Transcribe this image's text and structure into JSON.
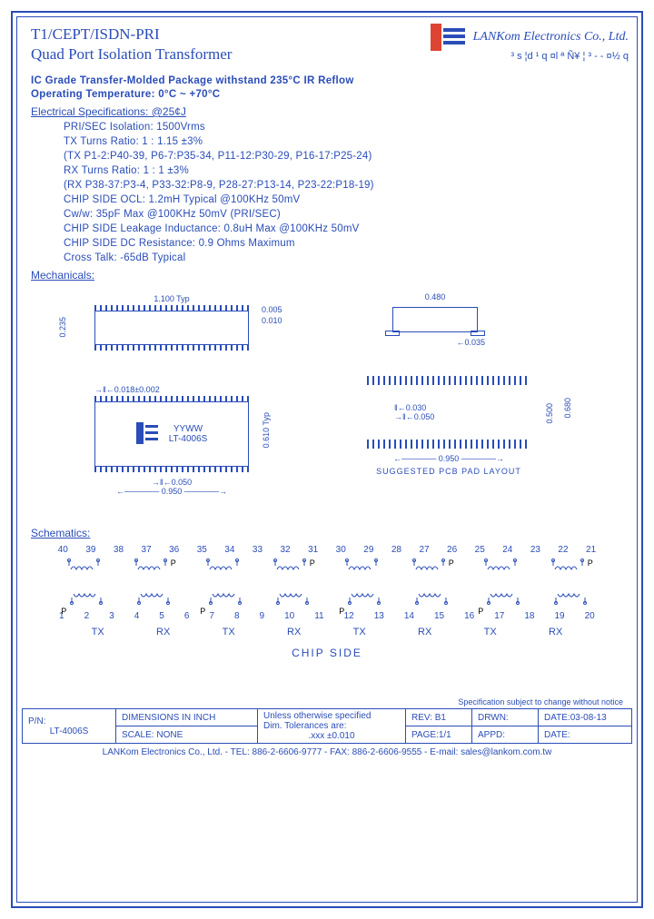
{
  "header": {
    "title1": "T1/CEPT/ISDN-PRI",
    "title2": "Quad Port Isolation Transformer",
    "company_name": "LANKom Electronics Co., Ltd.",
    "company_sub": "³ s ¦d ¹ q ¤l ª Ñ¥ ¦ ³  - -  ¤½ q"
  },
  "grade_line1": "IC Grade Transfer-Molded Package withstand 235°C IR Reflow",
  "grade_line2": "Operating Temperature: 0°C ~ +70°C",
  "elec_header": "Electrical Specifications: @25¢J",
  "specs": {
    "iso": "PRI/SEC Isolation: 1500Vrms",
    "tx_ratio": "TX Turns Ratio: 1 : 1.15 ±3%",
    "tx_pins": "(TX P1-2:P40-39, P6-7:P35-34, P11-12:P30-29, P16-17:P25-24)",
    "rx_ratio": "RX Turns Ratio: 1 : 1 ±3%",
    "rx_pins": "(RX P38-37:P3-4, P33-32:P8-9, P28-27:P13-14, P23-22:P18-19)",
    "ocl": "CHIP SIDE OCL: 1.2mH Typical @100KHz 50mV",
    "cww": "Cw/w: 35pF Max @100KHz 50mV (PRI/SEC)",
    "leak": "CHIP SIDE Leakage Inductance: 0.8uH Max @100KHz 50mV",
    "dcr": "CHIP SIDE DC Resistance: 0.9 Ohms Maximum",
    "xtalk": "Cross Talk: -65dB Typical"
  },
  "mech_header": "Mechanicals:",
  "mech": {
    "d1": "1.100 Typ",
    "d2": "0.235",
    "d3": "0.005",
    "d4": "0.010",
    "d5": "0.480",
    "d6": "0.035",
    "d7": "0.018±0.002",
    "d8": "0.610 Typ",
    "d9": "0.050",
    "d10": "0.950",
    "d11": "0.030",
    "d12": "0.050",
    "d13": "0.500",
    "d14": "0.680",
    "d15": "0.950",
    "pcb_label": "SUGGESTED PCB PAD LAYOUT",
    "chip_mark1": "YYWW",
    "chip_mark2": "LT-4006S"
  },
  "schem_header": "Schematics:",
  "schem": {
    "top_pins": [
      "40",
      "39",
      "38",
      "37",
      "36",
      "35",
      "34",
      "33",
      "32",
      "31",
      "30",
      "29",
      "28",
      "27",
      "26",
      "25",
      "24",
      "23",
      "22",
      "21"
    ],
    "bot_pins": [
      "1",
      "2",
      "3",
      "4",
      "5",
      "6",
      "7",
      "8",
      "9",
      "10",
      "11",
      "12",
      "13",
      "14",
      "15",
      "16",
      "17",
      "18",
      "19",
      "20"
    ],
    "labels": [
      "TX",
      "RX",
      "TX",
      "RX",
      "TX",
      "RX",
      "TX",
      "RX"
    ],
    "p": "P",
    "chipside": "CHIP SIDE"
  },
  "notice": "Specification subject to change without notice",
  "titleblock": {
    "pn_label": "P/N:",
    "pn": "LT-4006S",
    "dim": "DIMENSIONS IN INCH",
    "scale": "SCALE: NONE",
    "tol1": "Unless otherwise specified",
    "tol2": "Dim. Tolerances are:",
    "tol3": ".xxx ±0.010",
    "rev": "REV: B1",
    "page": "PAGE:1/1",
    "drwn": "DRWN:",
    "appd": "APPD:",
    "date1": "DATE:03-08-13",
    "date2": "DATE:"
  },
  "footer": "LANKom Electronics Co., Ltd. - TEL: 886-2-6606-9777 - FAX: 886-2-6606-9555 - E-mail: sales@lankom.com.tw"
}
